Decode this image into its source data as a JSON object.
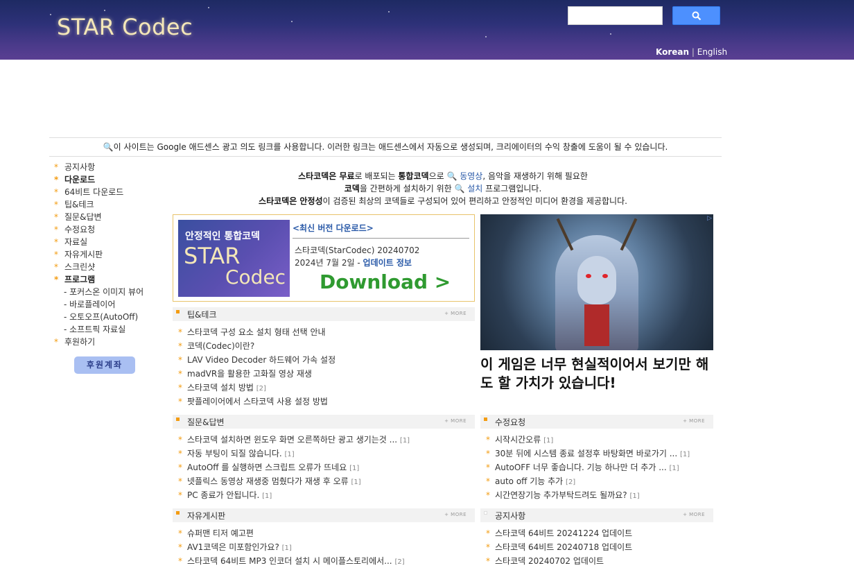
{
  "header": {
    "logo": "STAR Codec",
    "search": {
      "value": "",
      "placeholder": ""
    },
    "lang": {
      "korean": "Korean",
      "separator": "|",
      "english": "English"
    }
  },
  "notice": "🔍이 사이트는 Google 애드센스 광고 의도 링크를 사용합니다. 이러한 링크는 애드센스에서 자동으로 생성되며, 크리에이터의 수익 창출에 도움이 될 수 있습니다.",
  "sidebar": {
    "items": [
      {
        "label": "공지사항",
        "bold": false
      },
      {
        "label": "다운로드",
        "bold": true
      },
      {
        "label": "64비트 다운로드",
        "bold": false
      },
      {
        "label": "팁&테크",
        "bold": false
      },
      {
        "label": "질문&답변",
        "bold": false
      },
      {
        "label": "수정요청",
        "bold": false
      },
      {
        "label": "자료실",
        "bold": false
      },
      {
        "label": "자유게시판",
        "bold": false
      },
      {
        "label": "스크린샷",
        "bold": false
      },
      {
        "label": "프로그램",
        "bold": true
      }
    ],
    "sub_items": [
      "- 포커스온 이미지 뷰어",
      "- 바로플레이어",
      "- 오토오프(AutoOff)",
      "- 소프트픽 자료실"
    ],
    "last_item": "후원하기",
    "donate_button": "후원계좌"
  },
  "intro": {
    "l1_a": "스타코덱은 ",
    "l1_b": "무료",
    "l1_c": "로 배포되는 ",
    "l1_d": "통합코덱",
    "l1_e": "으로 ",
    "l1_link": "🔍 동영상",
    "l1_f": ", 음악을 재생하기 위해 필요한",
    "l2_a": "코덱",
    "l2_b": "을 간편하게 설치하기 위한 ",
    "l2_link": "🔍 설치",
    "l2_c": " 프로그램입니다.",
    "l3_a": "스타코덱은 ",
    "l3_b": "안정성",
    "l3_c": "이 검증된 최상의 코덱들로 구성되어 있어 편리하고 안정적인 미디어 환경을 제공합니다."
  },
  "download_box": {
    "banner_line1": "안정적인 통합코덱",
    "banner_line2": "STAR",
    "banner_line3": "Codec",
    "latest": "<최신 버전 다운로드>",
    "version": "스타코덱(StarCodec) 20240702",
    "date": "2024년 7월 2일 - ",
    "update_link": "업데이트 정보",
    "download": "Download  >"
  },
  "ad": {
    "corner": "▷",
    "headline": "이 게임은 너무 현실적이어서 보기만 해도 할 가치가 있습니다!"
  },
  "boards": {
    "more": "+ MORE",
    "tips": {
      "title": "팁&테크",
      "items": [
        {
          "text": "스타코덱 구성 요소 설치 형태 선택 안내",
          "count": ""
        },
        {
          "text": "코덱(Codec)이란?",
          "count": ""
        },
        {
          "text": "LAV Video Decoder 하드웨어 가속 설정",
          "count": ""
        },
        {
          "text": "madVR을 활용한 고화질 영상 재생",
          "count": ""
        },
        {
          "text": "스타코덱 설치 방법",
          "count": "[2]"
        },
        {
          "text": "팟플레이어에서 스타코덱 사용 설정 방법",
          "count": ""
        }
      ]
    },
    "qa": {
      "title": "질문&답변",
      "items": [
        {
          "text": "스타코덱 설치하면 윈도우 화면 오른쪽하단 광고 생기는것 ... ",
          "count": "[1]"
        },
        {
          "text": "자동 부팅이 되질 않습니다. ",
          "count": "[1]"
        },
        {
          "text": "AutoOff 를 실행하면 스크립트 오류가 뜨네요 ",
          "count": "[1]"
        },
        {
          "text": "넷플릭스 동영상 재생중 멈췄다가 재생 후 오류 ",
          "count": "[1]"
        },
        {
          "text": "PC 종료가 안됩니다. ",
          "count": "[1]"
        }
      ]
    },
    "req": {
      "title": "수정요청",
      "items": [
        {
          "text": "시작시간오류 ",
          "count": "[1]"
        },
        {
          "text": "30분 뒤에 시스템 종료 설정후 바탕화면 바로가기 ... ",
          "count": "[1]"
        },
        {
          "text": "AutoOFF 너무 좋습니다. 기능 하나만 더 추가 ... ",
          "count": "[1]"
        },
        {
          "text": "auto off 기능 추가 ",
          "count": "[2]"
        },
        {
          "text": "시간연장기능 추가부탁드려도 될까요? ",
          "count": "[1]"
        }
      ]
    },
    "free": {
      "title": "자유게시판",
      "items": [
        {
          "text": "슈퍼맨 티저 예고편",
          "count": ""
        },
        {
          "text": "AV1코덱은 미포함인가요? ",
          "count": "[1]"
        },
        {
          "text": "스타코덱 64비트 MP3 인코더 설치 시 메이플스토리에서... ",
          "count": "[2]"
        }
      ]
    },
    "notice": {
      "title": "공지사항",
      "items": [
        {
          "text": "스타코덱 64비트 20241224 업데이트",
          "count": ""
        },
        {
          "text": "스타코덱 64비트 20240718 업데이트",
          "count": ""
        },
        {
          "text": "스타코덱 20240702 업데이트",
          "count": ""
        }
      ]
    }
  },
  "colors": {
    "header_top": "#1e2a63",
    "header_bottom": "#5a3f92",
    "accent": "#f39c12",
    "link": "#2a5aa8",
    "download": "#2f9a30"
  }
}
